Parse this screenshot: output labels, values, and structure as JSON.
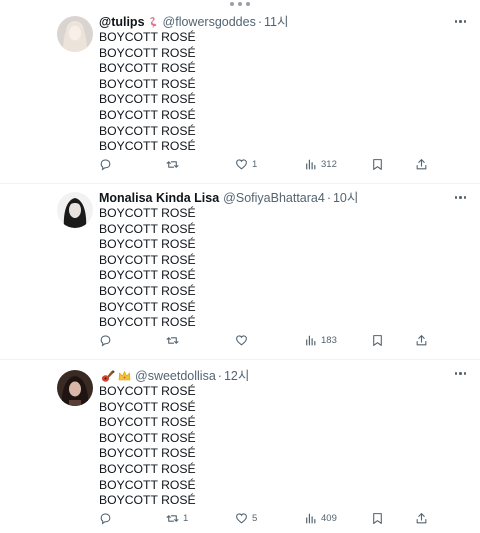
{
  "tweets": [
    {
      "display_name": "@tulips",
      "name_emoji": "flamingo-emoji",
      "handle": "@flowersgoddes",
      "time": "11시",
      "lines": [
        "BOYCOTT ROSÉ",
        "BOYCOTT ROSÉ",
        "BOYCOTT ROSÉ",
        "BOYCOTT ROSÉ",
        "BOYCOTT ROSÉ",
        "BOYCOTT ROSÉ",
        "BOYCOTT ROSÉ",
        "BOYCOTT ROSÉ"
      ],
      "replies": "",
      "retweets": "",
      "likes": "1",
      "views": "312"
    },
    {
      "display_name": "Monalisa Kinda Lisa",
      "handle": "@SofiyaBhattara4",
      "time": "10시",
      "lines": [
        "BOYCOTT ROSÉ",
        "BOYCOTT ROSÉ",
        "BOYCOTT ROSÉ",
        "BOYCOTT ROSÉ",
        "BOYCOTT ROSÉ",
        "BOYCOTT ROSÉ",
        "BOYCOTT ROSÉ",
        "BOYCOTT ROSÉ"
      ],
      "replies": "",
      "retweets": "",
      "likes": "",
      "views": "183"
    },
    {
      "display_name": "",
      "name_emojis": [
        "guitar-emoji",
        "crown-emoji"
      ],
      "handle": "@sweetdollisa",
      "time": "12시",
      "lines": [
        "BOYCOTT ROSÉ",
        "BOYCOTT ROSÉ",
        "BOYCOTT ROSÉ",
        "BOYCOTT ROSÉ",
        "BOYCOTT ROSÉ",
        "BOYCOTT ROSÉ",
        "BOYCOTT ROSÉ",
        "BOYCOTT ROSÉ"
      ],
      "replies": "",
      "retweets": "1",
      "likes": "5",
      "views": "409"
    }
  ],
  "separator": "·",
  "colors": {
    "text": "#0f1419",
    "secondary": "#536471",
    "divider": "#eff3f4"
  }
}
